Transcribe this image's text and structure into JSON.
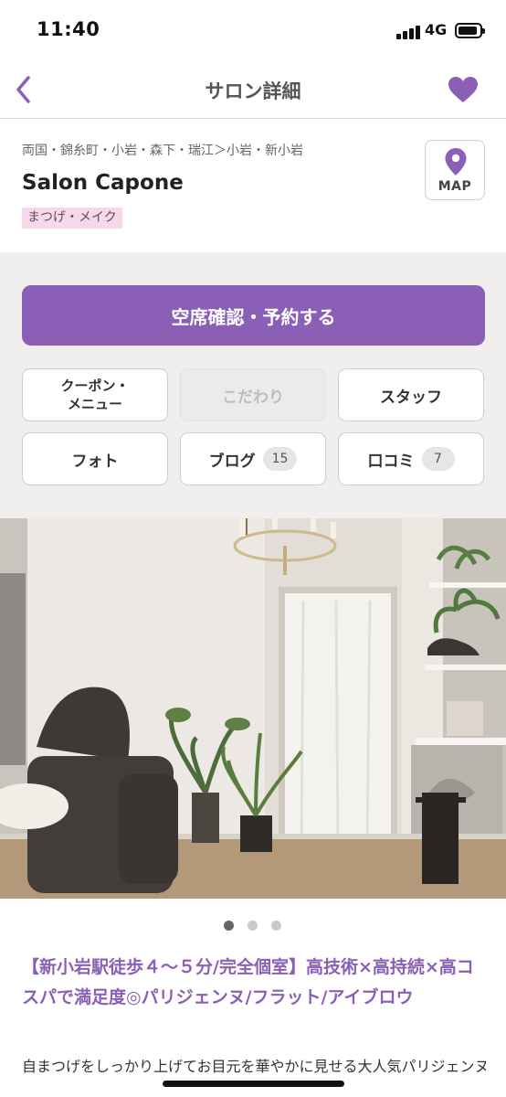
{
  "status_bar": {
    "time": "11:40",
    "network": "4G"
  },
  "header": {
    "title": "サロン詳細",
    "back_icon": "chevron-left-icon",
    "favorite_icon": "heart-icon"
  },
  "salon": {
    "area": "両国・錦糸町・小岩・森下・瑞江＞小岩・新小岩",
    "name": "Salon Capone",
    "genre": "まつげ・メイク",
    "map_label": "MAP"
  },
  "actions": {
    "reserve": "空席確認・予約する",
    "tabs": {
      "coupon_line1": "クーポン・",
      "coupon_line2": "メニュー",
      "kodawari": "こだわり",
      "staff": "スタッフ",
      "photo": "フォト",
      "blog": "ブログ",
      "blog_count": "15",
      "review": "口コミ",
      "review_count": "7"
    }
  },
  "carousel": {
    "total": 3,
    "active_index": 0
  },
  "catch_copy": "【新小岩駅徒歩４～５分/完全個室】高技術×高持続×高コスパで満足度◎パリジェンヌ/フラット/アイブロウ",
  "description": "自まつげをしっかり上げてお目元を華やかに見せる大人気パリジェンヌラッシュリフト、圧倒的な持続力を誇るオードリーフ",
  "colors": {
    "accent": "#8a5fb5",
    "genre_bg": "#f7d7ea",
    "section_bg": "#f0efee"
  }
}
